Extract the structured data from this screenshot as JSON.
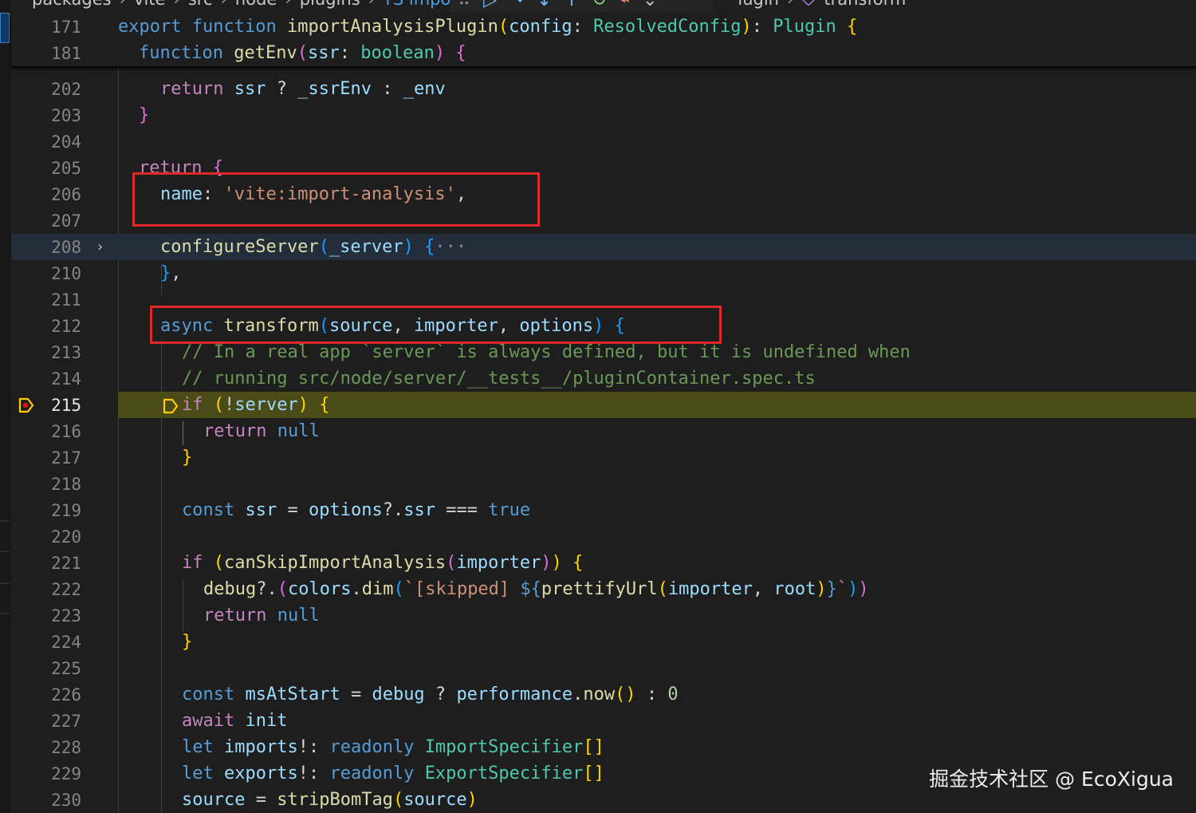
{
  "breadcrumb": {
    "items": [
      "packages",
      "vite",
      "src",
      "node",
      "plugins",
      "TS impo",
      "lugin",
      "transform"
    ]
  },
  "debug_toolbar": {
    "icons": [
      "drag-handle-icon",
      "continue-icon",
      "step-over-icon",
      "step-into-icon",
      "step-out-icon",
      "restart-icon",
      "disconnect-icon"
    ]
  },
  "sticky": [
    {
      "ln": "171",
      "text": "export function importAnalysisPlugin(config: ResolvedConfig): Plugin {"
    },
    {
      "ln": "181",
      "text": "function getEnv(ssr: boolean) {"
    }
  ],
  "lines": [
    {
      "ln": "202",
      "text": "return ssr ? _ssrEnv : _env"
    },
    {
      "ln": "203",
      "text": "}"
    },
    {
      "ln": "204",
      "text": ""
    },
    {
      "ln": "205",
      "text": "return {"
    },
    {
      "ln": "206",
      "text": "name: 'vite:import-analysis',"
    },
    {
      "ln": "207",
      "text": ""
    },
    {
      "ln": "208",
      "text": "configureServer(_server) {···"
    },
    {
      "ln": "210",
      "text": "},"
    },
    {
      "ln": "211",
      "text": ""
    },
    {
      "ln": "212",
      "text": "async transform(source, importer, options) {"
    },
    {
      "ln": "213",
      "text": "// In a real app `server` is always defined, but it is undefined when"
    },
    {
      "ln": "214",
      "text": "// running src/node/server/__tests__/pluginContainer.spec.ts"
    },
    {
      "ln": "215",
      "text": "if (!server) {"
    },
    {
      "ln": "216",
      "text": "return null"
    },
    {
      "ln": "217",
      "text": "}"
    },
    {
      "ln": "218",
      "text": ""
    },
    {
      "ln": "219",
      "text": "const ssr = options?.ssr === true"
    },
    {
      "ln": "220",
      "text": ""
    },
    {
      "ln": "221",
      "text": "if (canSkipImportAnalysis(importer)) {"
    },
    {
      "ln": "222",
      "text": "debug?.(colors.dim(`[skipped] ${prettifyUrl(importer, root)}`))"
    },
    {
      "ln": "223",
      "text": "return null"
    },
    {
      "ln": "224",
      "text": "}"
    },
    {
      "ln": "225",
      "text": ""
    },
    {
      "ln": "226",
      "text": "const msAtStart = debug ? performance.now() : 0"
    },
    {
      "ln": "227",
      "text": "await init"
    },
    {
      "ln": "228",
      "text": "let imports!: readonly ImportSpecifier[]"
    },
    {
      "ln": "229",
      "text": "let exports!: readonly ExportSpecifier[]"
    },
    {
      "ln": "230",
      "text": "source = stripBomTag(source)"
    }
  ],
  "watermark": "掘金技术社区 @ EcoXigua",
  "colors": {
    "editor_bg": "#1e1e1e",
    "current_line": "#4b4b18",
    "highlight_box": "#e0282b",
    "keyword": "#569cd6",
    "control": "#c586c0",
    "function": "#dcdcaa",
    "variable": "#9cdcfe",
    "type": "#4ec9b0",
    "string": "#ce9178",
    "comment": "#6a9955"
  }
}
